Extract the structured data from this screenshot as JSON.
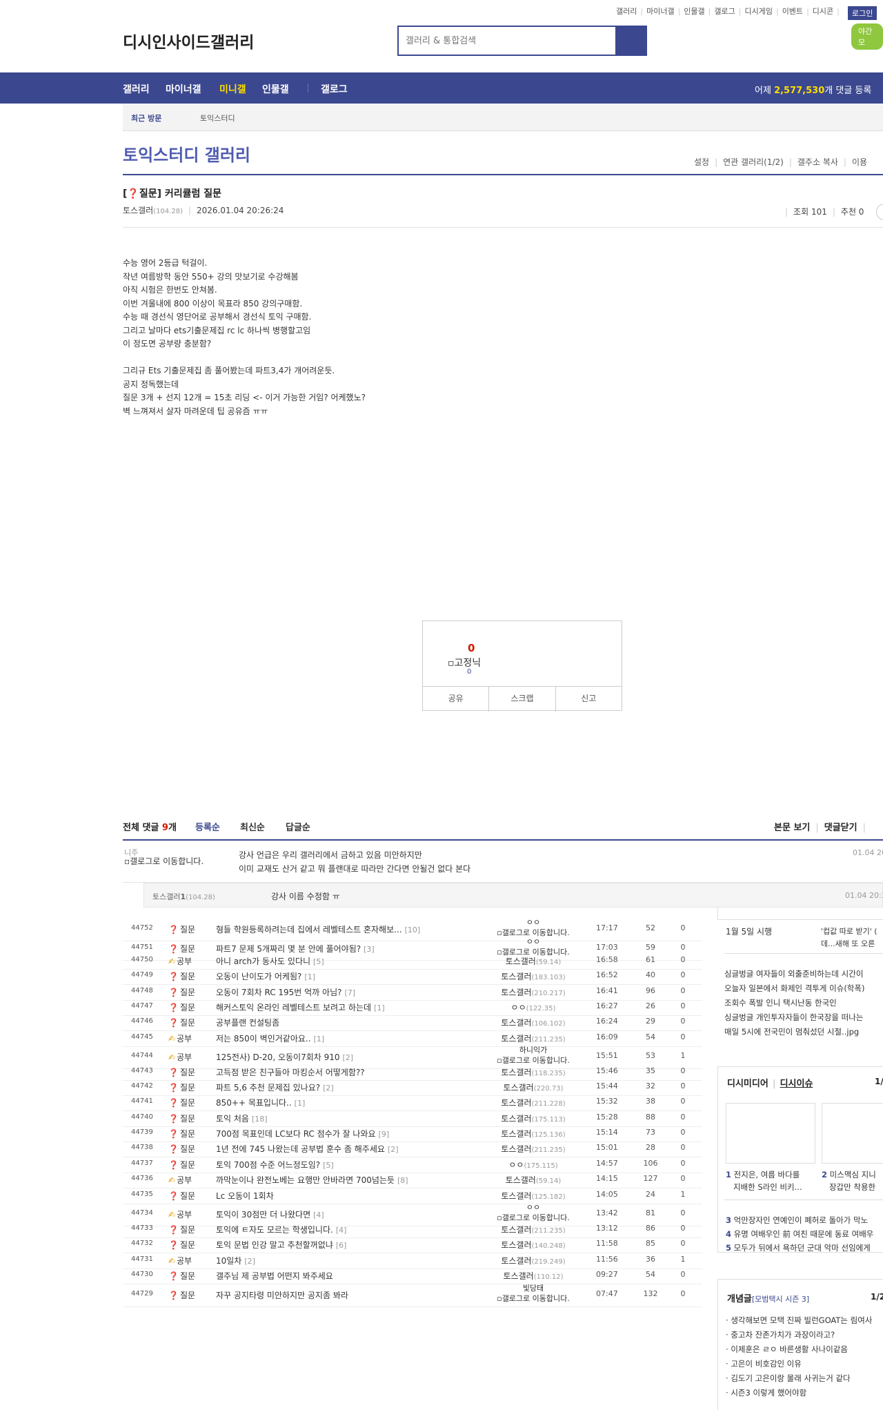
{
  "top_links": [
    "갤러리",
    "마이너갤",
    "인물갤",
    "갤로그",
    "디시게임",
    "이벤트",
    "디시콘"
  ],
  "login_label": "로그인",
  "night_label": "야간 모",
  "logo_alt": "디시인사이드갤러리",
  "search": {
    "placeholder": "갤러리 & 통합검색"
  },
  "nav": {
    "items": [
      "갤러리",
      "마이너갤",
      "미니갤",
      "인물갤",
      "갤로그"
    ],
    "stat_prefix": "어제 ",
    "stat_value": "2,577,530",
    "stat_suffix": "개 댓글 등록"
  },
  "recent": {
    "label": "최근 방문",
    "item": "토익스터디"
  },
  "gallery": {
    "title": "토익스터디 갤러리",
    "tools": [
      "설정",
      "연관 갤러리(1/2)",
      "갤주소 복사",
      "이용"
    ]
  },
  "post": {
    "title": "[❓질문] 커리큘럼 질문",
    "author": "토스갤러",
    "ip": "(104.28)",
    "date": "2026.01.04 20:26:24",
    "views": "조회 101",
    "recommend": "추천 0",
    "body": [
      "수능 영어 2등급 턱걸이.",
      "작년 여름방학 동안 550+ 강의 맛보기로 수강해봄",
      "아직 시험은 한번도 안쳐봄.",
      "이번 겨울내에 800 이상이 목표라 850 강의구매함.",
      "수능 때 경선식 영단어로 공부해서 경선식 토익 구매함.",
      "그리고 날마다 ets기출문제집 rc lc 하나씩 병행할고임",
      "이 정도면 공부량 충분함?",
      "",
      "그리규 Ets 기출문제집 좀 풀어봤는데 파트3,4가 개어려운듯.",
      "공지 정독했는데",
      "질문 3개 + 선지 12개 = 15초 리딩 <- 이거 가능한 거임? 어케했노?",
      "벽 느껴져서 살자 마려운데 팁 공유즘 ㅠㅠ"
    ]
  },
  "recommend_box": {
    "count": "0",
    "fixed_nick_alt": "고정닉",
    "fixed_count": "0",
    "buttons": [
      "공유",
      "스크랩",
      "신고"
    ]
  },
  "comments": {
    "total_label": "전체 댓글 ",
    "total_count": "9",
    "total_suffix": "개",
    "sort_tabs": [
      "등록순",
      "최신순",
      "답글순"
    ],
    "right_links": [
      "본문 보기",
      "댓글닫기"
    ],
    "items": [
      {
        "nick": "니주",
        "img_alt": "갤로그로 이동합니다.",
        "lines": [
          "강사 언급은 우리 갤러리에서 금하고 있음 미안하지만",
          "이미 교재도 산거 같고 뭐 플랜대로 따라만 간다면 안될건 없다 본다"
        ],
        "time": "01.04 20"
      },
      {
        "nick": "토스갤러",
        "nick_no": "1",
        "ip": "(104.28)",
        "text": "강사 이름 수정함 ㅠ",
        "time": "01.04 20:3"
      }
    ]
  },
  "list": [
    {
      "no": "44752",
      "head": "질문",
      "title": "형들 학원등록하려는데 집에서 레벨테스트 혼자해보...",
      "replies": "[10]",
      "writer": "ㅇㅇ",
      "writer_img": "갤로그로 이동합니다.",
      "time": "17:17",
      "views": "52",
      "rec": "0"
    },
    {
      "no": "44751",
      "head": "질문",
      "title": "파트7 문제 5개짜리 몇 분 안에 풀어야됨?",
      "replies": "[3]",
      "writer": "ㅇㅇ",
      "writer_img": "갤로그로 이동합니다.",
      "time": "17:03",
      "views": "59",
      "rec": "0"
    },
    {
      "no": "44750",
      "head": "공부",
      "title": "아니 arch가 동사도 있다니",
      "replies": "[5]",
      "writer": "토스갤러",
      "ip": "(59.14)",
      "time": "16:58",
      "views": "61",
      "rec": "0"
    },
    {
      "no": "44749",
      "head": "질문",
      "title": "오동이 난이도가 어케됨?",
      "replies": "[1]",
      "writer": "토스갤러",
      "ip": "(183.103)",
      "time": "16:52",
      "views": "40",
      "rec": "0"
    },
    {
      "no": "44748",
      "head": "질문",
      "title": "오동이 7회차 RC 195번 억까 아님?",
      "replies": "[7]",
      "writer": "토스갤러",
      "ip": "(210.217)",
      "time": "16:41",
      "views": "96",
      "rec": "0"
    },
    {
      "no": "44747",
      "head": "질문",
      "title": "해커스토익 온라인 레벨테스트 보려고 하는데",
      "replies": "[1]",
      "writer": "ㅇㅇ",
      "ip": "(122.35)",
      "time": "16:27",
      "views": "26",
      "rec": "0"
    },
    {
      "no": "44746",
      "head": "질문",
      "title": "공부플랜 컨설팅좀",
      "replies": "",
      "writer": "토스갤러",
      "ip": "(106.102)",
      "time": "16:24",
      "views": "29",
      "rec": "0"
    },
    {
      "no": "44745",
      "head": "공부",
      "title": "저는 850이 벽인거같아요..",
      "replies": "[1]",
      "writer": "토스갤러",
      "ip": "(211.235)",
      "time": "16:09",
      "views": "54",
      "rec": "0"
    },
    {
      "no": "44744",
      "head": "공부",
      "title": "125전사) D-20, 오동이7회차 910",
      "replies": "[2]",
      "writer": "하니익가",
      "writer_img": "갤로그로 이동합니다.",
      "time": "15:51",
      "views": "53",
      "rec": "1"
    },
    {
      "no": "44743",
      "head": "질문",
      "title": "고득점 받은 친구들아 마킹순서 어떻게함??",
      "replies": "",
      "writer": "토스갤러",
      "ip": "(118.235)",
      "time": "15:46",
      "views": "35",
      "rec": "0"
    },
    {
      "no": "44742",
      "head": "질문",
      "title": "파트 5,6 추천 문제집 있나요?",
      "replies": "[2]",
      "writer": "토스갤러",
      "ip": "(220.73)",
      "time": "15:44",
      "views": "32",
      "rec": "0"
    },
    {
      "no": "44741",
      "head": "질문",
      "title": "850++ 목표입니다..",
      "replies": "[1]",
      "writer": "토스갤러",
      "ip": "(211.228)",
      "time": "15:32",
      "views": "38",
      "rec": "0"
    },
    {
      "no": "44740",
      "head": "질문",
      "title": "토익 처음",
      "replies": "[18]",
      "writer": "토스갤러",
      "ip": "(175.113)",
      "time": "15:28",
      "views": "88",
      "rec": "0"
    },
    {
      "no": "44739",
      "head": "질문",
      "title": "700점 목표인데 LC보다 RC 점수가 잘 나와요",
      "replies": "[9]",
      "writer": "토스갤러",
      "ip": "(125.136)",
      "time": "15:14",
      "views": "73",
      "rec": "0"
    },
    {
      "no": "44738",
      "head": "질문",
      "title": "1년 전에 745 나왔는데 공부법 훈수 좀 해주세요",
      "replies": "[2]",
      "writer": "토스갤러",
      "ip": "(211.235)",
      "time": "15:01",
      "views": "28",
      "rec": "0"
    },
    {
      "no": "44737",
      "head": "질문",
      "title": "토익 700점 수준 어느정도임?",
      "replies": "[5]",
      "writer": "ㅇㅇ",
      "ip": "(175.115)",
      "time": "14:57",
      "views": "106",
      "rec": "0"
    },
    {
      "no": "44736",
      "head": "공부",
      "title": "까막눈이나 완전노베는 요행만 안바라면 700넘는듯",
      "replies": "[8]",
      "writer": "토스갤러",
      "ip": "(59.14)",
      "time": "14:15",
      "views": "127",
      "rec": "0"
    },
    {
      "no": "44735",
      "head": "질문",
      "title": "Lc 오동이 1회차",
      "replies": "",
      "writer": "토스갤러",
      "ip": "(125.182)",
      "time": "14:05",
      "views": "24",
      "rec": "1"
    },
    {
      "no": "44734",
      "head": "공부",
      "title": "토익이 30점만 더 나왔다면",
      "replies": "[4]",
      "writer": "ㅇㅇ",
      "writer_img": "갤로그로 이동합니다.",
      "time": "13:42",
      "views": "81",
      "rec": "0"
    },
    {
      "no": "44733",
      "head": "질문",
      "title": "토익에 ㅌ자도 모르는 학생입니다.",
      "replies": "[4]",
      "writer": "토스갤러",
      "ip": "(211.235)",
      "time": "13:12",
      "views": "86",
      "rec": "0"
    },
    {
      "no": "44732",
      "head": "질문",
      "title": "토익 문법 인강 말고 추천할꺼없냐",
      "replies": "[6]",
      "writer": "토스갤러",
      "ip": "(140.248)",
      "time": "11:58",
      "views": "85",
      "rec": "0"
    },
    {
      "no": "44731",
      "head": "공부",
      "title": "10일차",
      "replies": "[2]",
      "writer": "토스갤러",
      "ip": "(219.249)",
      "time": "11:56",
      "views": "36",
      "rec": "1"
    },
    {
      "no": "44730",
      "head": "질문",
      "title": "갤주님 제 공부법 어떤지 봐주세요",
      "replies": "",
      "writer": "토스갤러",
      "ip": "(110.12)",
      "time": "09:27",
      "views": "54",
      "rec": "0"
    },
    {
      "no": "44729",
      "head": "질문",
      "title": "자꾸 공지타령 미안하지만 공지좀 봐라",
      "replies": "",
      "writer": "빛당태",
      "writer_img": "갤로그로 이동합니다.",
      "time": "07:47",
      "views": "132",
      "rec": "0"
    }
  ],
  "sidebar": {
    "top_left": "1월 5일 시행",
    "top_right": [
      "'컵값 따로 받기' (",
      "데...새해 또 오른"
    ],
    "headlines": [
      "싱글벙글 여자들이 외출준비하는데 시간이",
      "오늘자 일본에서 화제인 격투게 이슈(학폭)",
      "조회수 폭발 인니 택시난동 한국인",
      "싱글벙글 개인투자자들이 한국장을 떠나는",
      "매일 5시에 전국민이 멈춰섰던 시절..jpg"
    ],
    "media_title_a": "디시미디어",
    "media_title_b": "디시이슈",
    "media_page": "1/",
    "media_caps": [
      {
        "n": "1",
        "lines": [
          "전지은, 여름 바다를",
          "지배한 S라인 비키..."
        ]
      },
      {
        "n": "2",
        "lines": [
          "미스맥심 지니",
          "장갑만 착용한"
        ]
      }
    ],
    "media_list": [
      {
        "n": "3",
        "text": "억만장자인 연예인이 폐허로 돌아가 막노"
      },
      {
        "n": "4",
        "text": "유명 여배우인 前 여친 때문에 동료 여배우"
      },
      {
        "n": "5",
        "text": "모두가 뒤에서 욕하던 군대 악마 선임에게"
      }
    ],
    "concept_title": "개념글",
    "concept_sub": "[모범택시 시즌 3]",
    "concept_page": "1/2",
    "concept_list": [
      "생각해보면 모택 진짜 빌런GOAT는 림여사",
      "중고차 잔존가치가 과장이라고?",
      "이제훈은 ㄹㅇ 바른생활 사나이같음",
      "고은이 비호감인 이유",
      "김도기 고은이랑 몰래 사귀는거 같다",
      "시즌3 이렇게 했어야함"
    ]
  }
}
